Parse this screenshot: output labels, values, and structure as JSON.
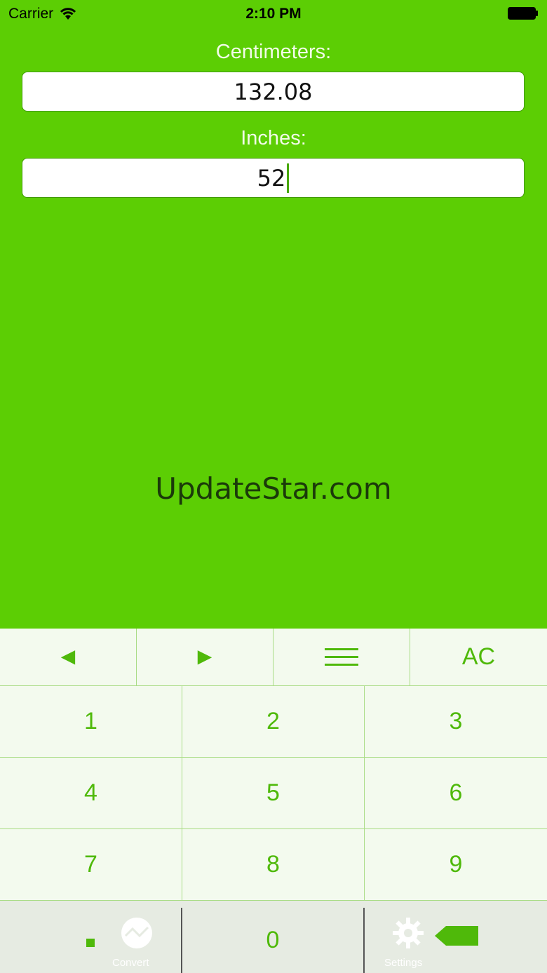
{
  "status_bar": {
    "carrier": "Carrier",
    "time": "2:10 PM"
  },
  "fields": [
    {
      "label": "Centimeters:",
      "value": "132.08"
    },
    {
      "label": "Inches:",
      "value": "52"
    }
  ],
  "watermark": "UpdateStar.com",
  "toolbar": {
    "left_label": "◄",
    "right_label": "►",
    "clear_label": "AC"
  },
  "keys": {
    "k1": "1",
    "k2": "2",
    "k3": "3",
    "k4": "4",
    "k5": "5",
    "k6": "6",
    "k7": "7",
    "k8": "8",
    "k9": "9",
    "k0": "0"
  },
  "tabbar": {
    "convert_label": "Convert",
    "settings_label": "Settings"
  },
  "colors": {
    "background": "#5cce04",
    "key_text": "#4fb90a",
    "keyboard_bg": "#f3faee"
  }
}
